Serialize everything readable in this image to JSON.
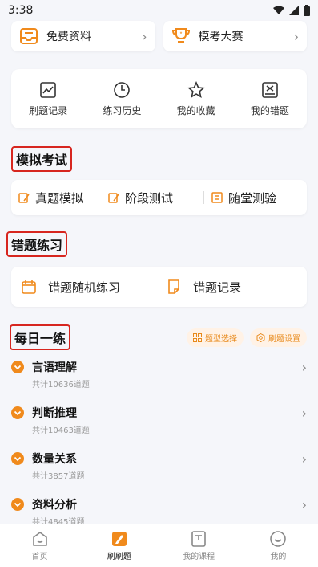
{
  "status": {
    "time": "3:38"
  },
  "top_cards": [
    {
      "label": "免费资料",
      "icon": "inbox-icon"
    },
    {
      "label": "模考大赛",
      "icon": "trophy-icon"
    }
  ],
  "tools": [
    {
      "label": "刷题记录",
      "icon": "chart-icon"
    },
    {
      "label": "练习历史",
      "icon": "clock-icon"
    },
    {
      "label": "我的收藏",
      "icon": "star-icon"
    },
    {
      "label": "我的错题",
      "icon": "wrong-box-icon"
    }
  ],
  "mock_exam": {
    "title": "模拟考试",
    "items": [
      "真题模拟",
      "阶段测试",
      "随堂测验"
    ]
  },
  "wrong_practice": {
    "title": "错题练习",
    "items": [
      "错题随机练习",
      "错题记录"
    ]
  },
  "daily": {
    "title": "每日一练",
    "pills": [
      "题型选择",
      "刷题设置"
    ],
    "items": [
      {
        "title": "言语理解",
        "sub": "共计10636道题"
      },
      {
        "title": "判断推理",
        "sub": "共计10463道题"
      },
      {
        "title": "数量关系",
        "sub": "共计3857道题"
      },
      {
        "title": "资料分析",
        "sub": "共计4845道题"
      }
    ]
  },
  "tabbar": [
    "首页",
    "刷刷题",
    "我的课程",
    "我的"
  ],
  "colors": {
    "accent": "#f08a1c",
    "highlight_border": "#d7261f"
  }
}
